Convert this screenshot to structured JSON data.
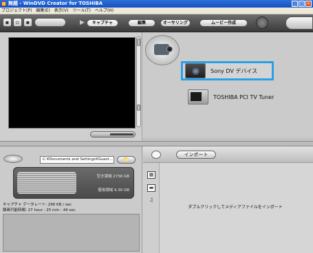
{
  "window": {
    "title": "無題 - WinDVD Creator for TOSHIBA",
    "controls": [
      "_",
      "□",
      "×"
    ]
  },
  "menu": [
    "プロジェクト(P)",
    "編集(E)",
    "表示(V)",
    "ツール(T)",
    "ヘルプ(H)"
  ],
  "toolbar": {
    "modes": [
      "キャプチャ",
      "編集",
      "オーサリング",
      "ムービー作成"
    ],
    "active_mode": "キャプチャ"
  },
  "devices": [
    {
      "label": "Sony DV デバイス",
      "icon": "dv-camera-icon",
      "selected": true
    },
    {
      "label": "TOSHIBA PCI TV Tuner",
      "icon": "tv-tuner-icon",
      "selected": false
    }
  ],
  "disk": {
    "path": "C:¥Documents and Settings¥Guest...",
    "free_space": "空き領域 2736 GB",
    "used_space": "使用領域 9.30 GB"
  },
  "capture_info": {
    "data_rate": "キャプチャ データレート: 296 KB / sec",
    "recordable_time": "録画可能時間: 27 hour : 25 min : 44 sec"
  },
  "import": {
    "button_label": "インポート",
    "hint": "ダブルクリックしてメディアファイルをインポート",
    "filter_icons": [
      "video-filter-icon",
      "image-filter-icon",
      "audio-filter-icon"
    ]
  },
  "colors": {
    "selection_border": "#28a0e8",
    "title_bar": "#1650c4"
  }
}
